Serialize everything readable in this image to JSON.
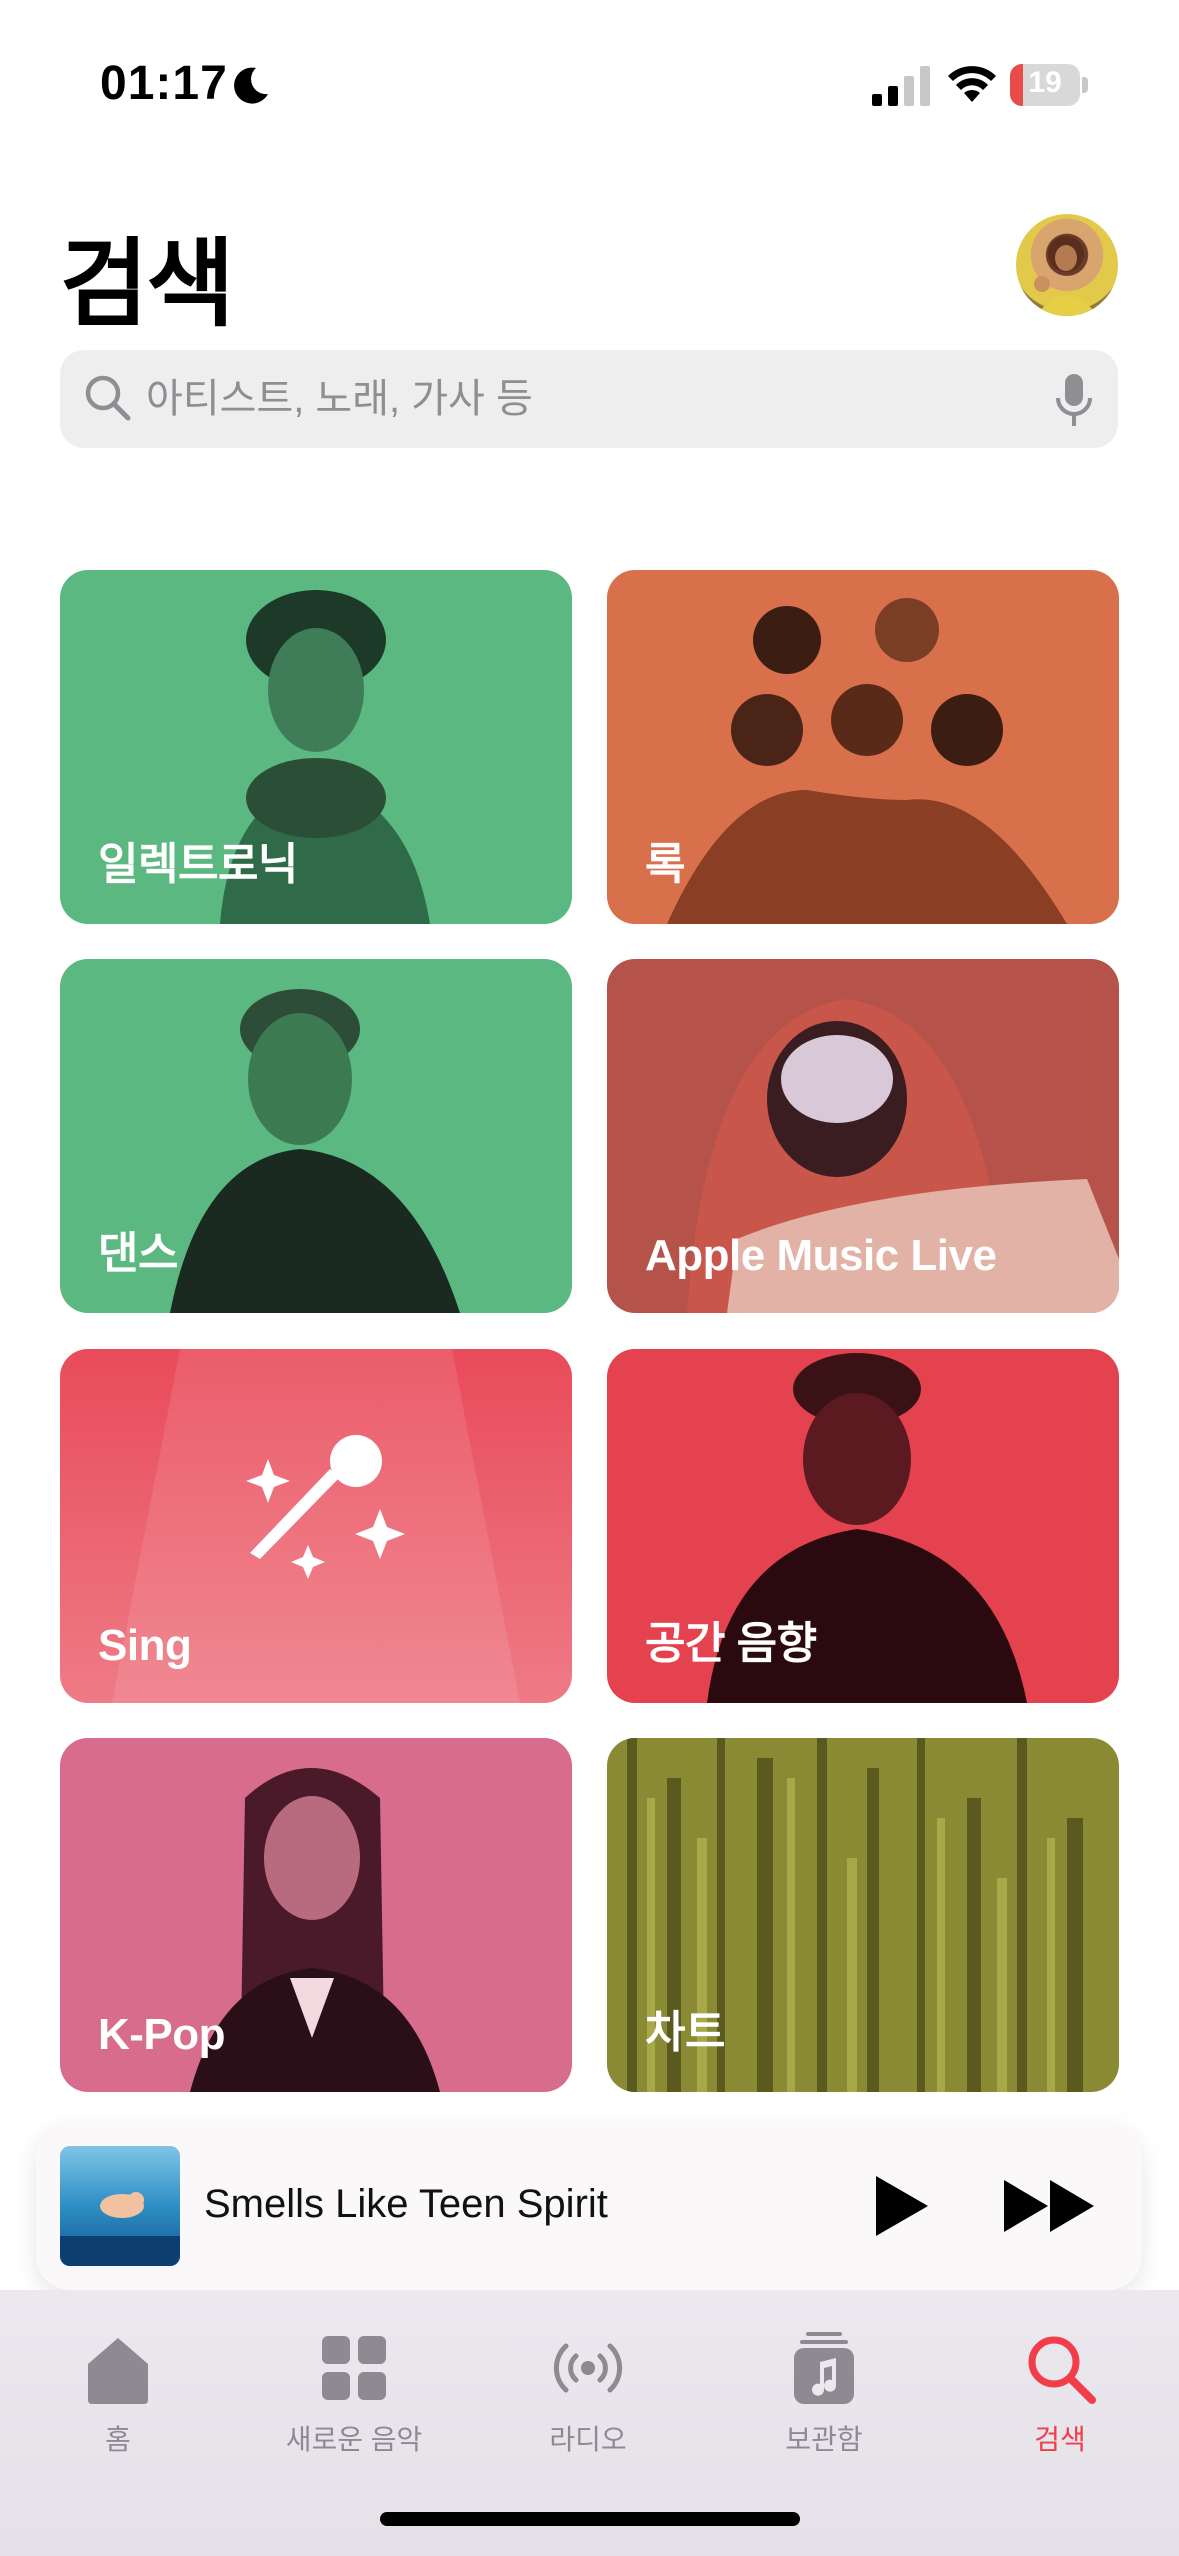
{
  "status_bar": {
    "time": "01:17",
    "battery_level": "19",
    "battery_fraction": 0.19
  },
  "header": {
    "title": "검색"
  },
  "search": {
    "placeholder": "아티스트, 노래, 가사 등"
  },
  "tiles": [
    {
      "label": "일렉트로닉",
      "color": "#5bb880"
    },
    {
      "label": "록",
      "color": "#d9704c"
    },
    {
      "label": "댄스",
      "color": "#5bb880"
    },
    {
      "label": "Apple Music Live",
      "color": "#b5524a"
    },
    {
      "label": "Sing",
      "color": "#ea5865"
    },
    {
      "label": "공간 음향",
      "color": "#e4424e"
    },
    {
      "label": "K-Pop",
      "color": "#d76c8c"
    },
    {
      "label": "차트",
      "color": "#8a8a34"
    }
  ],
  "now_playing": {
    "title": "Smells Like Teen Spirit"
  },
  "tab_bar": {
    "items": [
      {
        "label": "홈",
        "icon": "home-icon"
      },
      {
        "label": "새로운 음악",
        "icon": "grid-icon"
      },
      {
        "label": "라디오",
        "icon": "radio-icon"
      },
      {
        "label": "보관함",
        "icon": "library-icon"
      },
      {
        "label": "검색",
        "icon": "search-icon",
        "active": true
      }
    ],
    "accent": "#f23d4a"
  }
}
